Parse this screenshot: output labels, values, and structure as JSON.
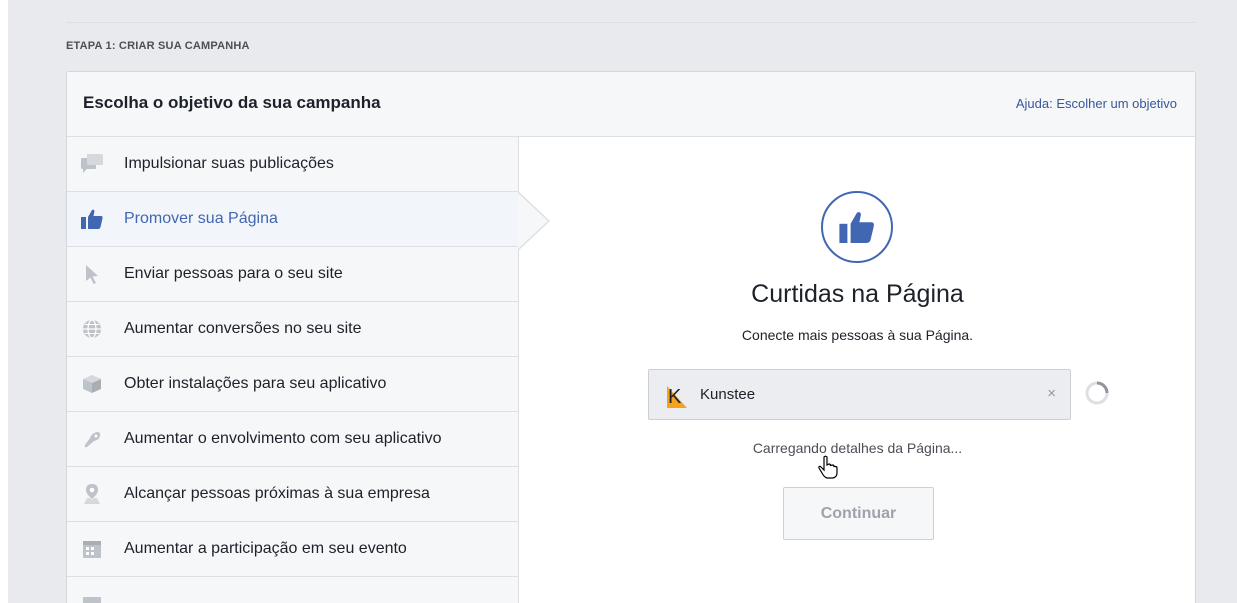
{
  "step": {
    "label": "ETAPA 1: CRIAR SUA CAMPANHA"
  },
  "panel": {
    "title": "Escolha o objetivo da sua campanha",
    "help_link": "Ajuda: Escolher um objetivo"
  },
  "objectives": [
    {
      "label": "Impulsionar suas publicações",
      "icon": "chat-bubbles-icon",
      "selected": false
    },
    {
      "label": "Promover sua Página",
      "icon": "thumbs-up-icon",
      "selected": true
    },
    {
      "label": "Enviar pessoas para o seu site",
      "icon": "cursor-icon",
      "selected": false
    },
    {
      "label": "Aumentar conversões no seu site",
      "icon": "globe-icon",
      "selected": false
    },
    {
      "label": "Obter instalações para seu aplicativo",
      "icon": "box-icon",
      "selected": false
    },
    {
      "label": "Aumentar o envolvimento com seu aplicativo",
      "icon": "gamepad-icon",
      "selected": false
    },
    {
      "label": "Alcançar pessoas próximas à sua empresa",
      "icon": "location-pin-icon",
      "selected": false
    },
    {
      "label": "Aumentar a participação em seu evento",
      "icon": "calendar-icon",
      "selected": false
    },
    {
      "label": "",
      "icon": "tag-icon",
      "selected": false
    }
  ],
  "detail": {
    "title": "Curtidas na Página",
    "subtitle": "Conecte mais pessoas à sua Página.",
    "page_select": {
      "value": "Kunstee",
      "clear": "×",
      "logo_letter": "K"
    },
    "loading_text": "Carregando detalhes da Página...",
    "continue_label": "Continuar"
  },
  "colors": {
    "accent": "#4267b2",
    "icon_gray": "#bec3c9",
    "logo_orange": "#f7a21b"
  }
}
